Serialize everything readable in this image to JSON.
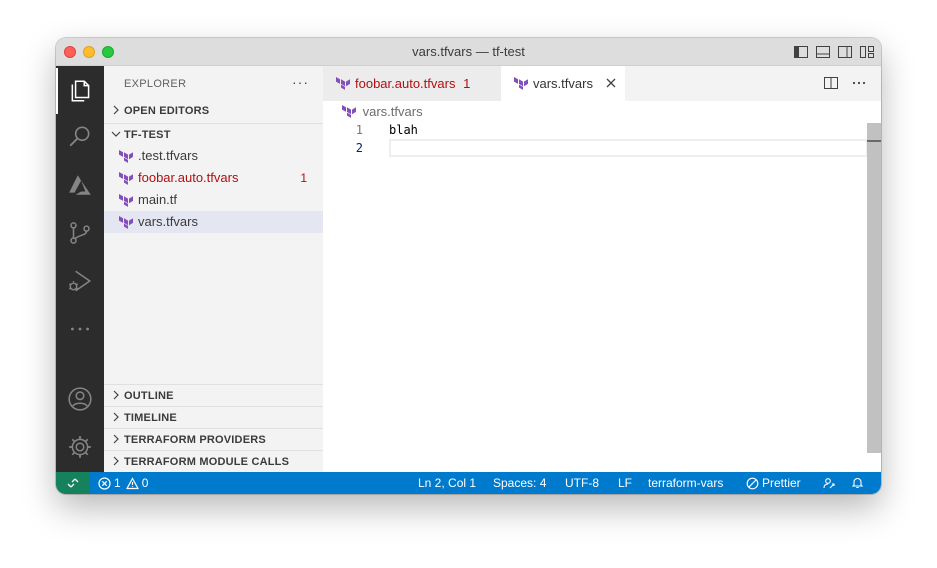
{
  "window": {
    "title": "vars.tfvars — tf-test"
  },
  "sidebar": {
    "title": "EXPLORER",
    "more": "···",
    "open_editors": "OPEN EDITORS",
    "folder": "TF-TEST",
    "files": [
      {
        "name": ".test.tfvars",
        "problems": ""
      },
      {
        "name": "foobar.auto.tfvars",
        "problems": "1"
      },
      {
        "name": "main.tf",
        "problems": ""
      },
      {
        "name": "vars.tfvars",
        "problems": ""
      }
    ],
    "sections": [
      "OUTLINE",
      "TIMELINE",
      "TERRAFORM PROVIDERS",
      "TERRAFORM MODULE CALLS"
    ]
  },
  "tabs": [
    {
      "label": "foobar.auto.tfvars",
      "badge": "1"
    },
    {
      "label": "vars.tfvars"
    }
  ],
  "breadcrumb": "vars.tfvars",
  "editor": {
    "lines": [
      {
        "number": "1",
        "text": "blah"
      },
      {
        "number": "2",
        "text": ""
      }
    ]
  },
  "status": {
    "errors": "1",
    "warnings": "0",
    "cursor": "Ln 2, Col 1",
    "spaces": "Spaces: 4",
    "encoding": "UTF-8",
    "eol": "LF",
    "language": "terraform-vars",
    "formatter": "Prettier"
  },
  "colors": {
    "accent": "#007acc",
    "remote": "#16825d",
    "error_text": "#b01011",
    "terraform_icon": "#844fba"
  }
}
